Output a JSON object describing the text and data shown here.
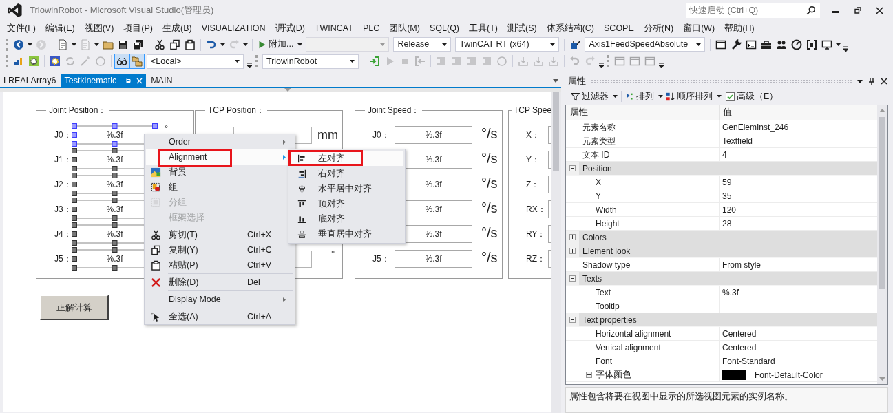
{
  "window": {
    "title": "TriowinRobot - Microsoft Visual Studio(管理员)",
    "quick_launch": {
      "placeholder": "快速启动 (Ctrl+Q)"
    }
  },
  "menu_bar": [
    "文件(F)",
    "编辑(E)",
    "视图(V)",
    "项目(P)",
    "生成(B)",
    "VISUALIZATION",
    "调试(D)",
    "TWINCAT",
    "PLC",
    "团队(M)",
    "SQL(Q)",
    "工具(T)",
    "测试(S)",
    "体系结构(C)",
    "SCOPE",
    "分析(N)",
    "窗口(W)",
    "帮助(H)"
  ],
  "toolbars": [
    [
      {
        "kind": "grip"
      },
      {
        "kind": "icon",
        "disabled": false,
        "toggled": false,
        "dropdown": true
      },
      {
        "kind": "icon",
        "disabled": true,
        "toggled": false
      },
      {
        "kind": "separator"
      },
      {
        "kind": "icon",
        "disabled": false,
        "toggled": false,
        "dropdown": true
      },
      {
        "kind": "icon",
        "disabled": true,
        "toggled": false,
        "dropdown": true
      },
      {
        "kind": "icon",
        "disabled": false,
        "toggled": false
      },
      {
        "kind": "icon",
        "disabled": false,
        "toggled": false
      },
      {
        "kind": "icon",
        "disabled": false,
        "toggled": false
      },
      {
        "kind": "separator"
      },
      {
        "kind": "icon",
        "disabled": false,
        "toggled": false
      },
      {
        "kind": "icon",
        "disabled": false,
        "toggled": false
      },
      {
        "kind": "icon",
        "disabled": false,
        "toggled": false
      },
      {
        "kind": "separator"
      },
      {
        "kind": "icon",
        "disabled": false,
        "toggled": false,
        "dropdown": true
      },
      {
        "kind": "icon",
        "disabled": true,
        "toggled": false,
        "dropdown": true
      },
      {
        "kind": "separator"
      },
      {
        "kind": "button",
        "label": "附加...",
        "dropdown": true
      },
      {
        "kind": "combo",
        "disabled": true
      },
      {
        "kind": "combo",
        "value": "Release",
        "disabled": false
      },
      {
        "kind": "combo",
        "value": "TwinCAT RT (x64)",
        "disabled": false
      },
      {
        "kind": "separator"
      },
      {
        "kind": "icon",
        "disabled": false,
        "toggled": false
      },
      {
        "kind": "combo",
        "value": "Axis1FeedSpeedAbsolute",
        "disabled": false
      },
      {
        "kind": "separator"
      },
      {
        "kind": "icon",
        "disabled": false,
        "toggled": false
      },
      {
        "kind": "icon",
        "disabled": false,
        "toggled": false
      },
      {
        "kind": "icon",
        "disabled": false,
        "toggled": false
      },
      {
        "kind": "icon",
        "disabled": false,
        "toggled": false
      },
      {
        "kind": "icon",
        "disabled": false,
        "toggled": false
      },
      {
        "kind": "icon",
        "disabled": false,
        "toggled": false
      },
      {
        "kind": "icon",
        "disabled": false,
        "toggled": false
      },
      {
        "kind": "icon",
        "disabled": false,
        "toggled": false,
        "dropdown": true
      },
      {
        "kind": "overflow"
      }
    ],
    [
      {
        "kind": "grip"
      },
      {
        "kind": "icon",
        "disabled": false,
        "toggled": false
      },
      {
        "kind": "icon",
        "disabled": false,
        "toggled": false
      },
      {
        "kind": "separator"
      },
      {
        "kind": "icon",
        "disabled": false,
        "toggled": false
      },
      {
        "kind": "icon",
        "disabled": true,
        "toggled": false
      },
      {
        "kind": "icon",
        "disabled": true,
        "toggled": false
      },
      {
        "kind": "icon",
        "disabled": true,
        "toggled": false
      },
      {
        "kind": "separator"
      },
      {
        "kind": "icon",
        "disabled": false,
        "toggled": true
      },
      {
        "kind": "icon",
        "disabled": false,
        "toggled": true
      },
      {
        "kind": "combo",
        "value": "<Local>",
        "disabled": false
      },
      {
        "kind": "overflow"
      },
      {
        "kind": "grip"
      },
      {
        "kind": "combo",
        "value": "TriowinRobot",
        "disabled": false
      },
      {
        "kind": "separator"
      },
      {
        "kind": "icon",
        "disabled": false,
        "toggled": false
      },
      {
        "kind": "icon",
        "disabled": true,
        "toggled": false
      },
      {
        "kind": "icon",
        "disabled": true,
        "toggled": false
      },
      {
        "kind": "icon",
        "disabled": true,
        "toggled": false
      },
      {
        "kind": "separator"
      },
      {
        "kind": "icon",
        "disabled": true,
        "toggled": false
      },
      {
        "kind": "icon",
        "disabled": true,
        "toggled": false
      },
      {
        "kind": "icon",
        "disabled": true,
        "toggled": false
      },
      {
        "kind": "icon",
        "disabled": true,
        "toggled": false
      },
      {
        "kind": "icon",
        "disabled": true,
        "toggled": false
      },
      {
        "kind": "separator"
      },
      {
        "kind": "icon",
        "disabled": true,
        "toggled": false
      },
      {
        "kind": "icon",
        "disabled": true,
        "toggled": false
      },
      {
        "kind": "icon",
        "disabled": true,
        "toggled": false
      },
      {
        "kind": "separator"
      },
      {
        "kind": "icon",
        "disabled": true,
        "toggled": false
      },
      {
        "kind": "icon",
        "disabled": true,
        "toggled": false
      },
      {
        "kind": "overflow"
      },
      {
        "kind": "grip"
      },
      {
        "kind": "icon",
        "disabled": true,
        "toggled": false
      },
      {
        "kind": "icon",
        "disabled": true,
        "toggled": false
      },
      {
        "kind": "icon",
        "disabled": true,
        "toggled": false
      },
      {
        "kind": "overflow"
      }
    ]
  ],
  "tabs": [
    {
      "label": "LREALArray6",
      "selected": false
    },
    {
      "label": "Testkinematic",
      "selected": true
    },
    {
      "label": "MAIN",
      "selected": false
    }
  ],
  "editor": {
    "joint_position": {
      "title": "Joint Position：",
      "rows": [
        {
          "label": "J0：",
          "value": "%.3f",
          "unit": "°",
          "selected": true
        },
        {
          "label": "J1：",
          "value": "%.3f",
          "selected": false
        },
        {
          "label": "J2：",
          "value": "%.3f",
          "selected": false
        },
        {
          "label": "J3：",
          "value": "%.3f",
          "selected": false
        },
        {
          "label": "J4：",
          "value": "%.3f",
          "selected": false
        },
        {
          "label": "J5：",
          "value": "%.3f",
          "selected": false
        }
      ]
    },
    "tcp_position": {
      "title": "TCP Position：",
      "units": [
        "mm",
        "°"
      ]
    },
    "joint_speed": {
      "title": "Joint Speed：",
      "rows": [
        {
          "label": "J0：",
          "value": "%.3f",
          "unit": "°/s"
        },
        {
          "value": "%.3f",
          "unit": "°/s"
        },
        {
          "value": "%.3f",
          "unit": "°/s"
        },
        {
          "value": "%.3f",
          "unit": "°/s"
        },
        {
          "value": "%.3f",
          "unit": "°/s"
        },
        {
          "label": "J5：",
          "value": "%.3f",
          "unit": "°/s"
        }
      ]
    },
    "tcp_speed": {
      "title": "TCP Spee",
      "rows": [
        {
          "label": "X："
        },
        {
          "label": "Y："
        },
        {
          "label": "Z："
        },
        {
          "label": "RX："
        },
        {
          "label": "RY："
        },
        {
          "label": "RZ："
        }
      ]
    },
    "button": "正解计算"
  },
  "context_menu": {
    "items": [
      {
        "kind": "item",
        "label": "Order",
        "submenu": true,
        "disabled": false,
        "selected": false,
        "annotated": false
      },
      {
        "kind": "item",
        "label": "Alignment",
        "submenu": true,
        "disabled": false,
        "selected": true,
        "annotated": true
      },
      {
        "kind": "item",
        "label": "背景",
        "submenu": false,
        "disabled": false,
        "selected": false,
        "annotated": false
      },
      {
        "kind": "item",
        "label": "组",
        "submenu": false,
        "disabled": false,
        "selected": false,
        "annotated": false
      },
      {
        "kind": "item",
        "label": "分组",
        "submenu": false,
        "disabled": true,
        "selected": false,
        "annotated": false
      },
      {
        "kind": "item",
        "label": "框架选择",
        "submenu": false,
        "disabled": true,
        "selected": false,
        "annotated": false
      },
      {
        "kind": "separator"
      },
      {
        "kind": "item",
        "label": "剪切(T)",
        "shortcut": "Ctrl+X",
        "submenu": false,
        "disabled": false,
        "selected": false,
        "annotated": false
      },
      {
        "kind": "item",
        "label": "复制(Y)",
        "shortcut": "Ctrl+C",
        "submenu": false,
        "disabled": false,
        "selected": false,
        "annotated": false
      },
      {
        "kind": "item",
        "label": "粘贴(P)",
        "shortcut": "Ctrl+V",
        "submenu": false,
        "disabled": false,
        "selected": false,
        "annotated": false
      },
      {
        "kind": "separator"
      },
      {
        "kind": "item",
        "label": "删除(D)",
        "shortcut": "Del",
        "submenu": false,
        "disabled": false,
        "selected": false,
        "annotated": false
      },
      {
        "kind": "separator"
      },
      {
        "kind": "item",
        "label": "Display Mode",
        "submenu": true,
        "disabled": false,
        "selected": false,
        "annotated": false
      },
      {
        "kind": "separator"
      },
      {
        "kind": "item",
        "label": "全选(A)",
        "shortcut": "Ctrl+A",
        "submenu": false,
        "disabled": false,
        "selected": false,
        "annotated": false
      }
    ]
  },
  "submenu": {
    "items": [
      {
        "label": "左对齐",
        "selected": true,
        "annotated": true
      },
      {
        "label": "右对齐",
        "selected": false,
        "annotated": false
      },
      {
        "label": "水平居中对齐",
        "selected": false,
        "annotated": false
      },
      {
        "label": "顶对齐",
        "selected": false,
        "annotated": false
      },
      {
        "label": "底对齐",
        "selected": false,
        "annotated": false
      },
      {
        "label": "垂直居中对齐",
        "selected": false,
        "annotated": false
      }
    ]
  },
  "properties_panel": {
    "title": "属性",
    "toolbar": [
      {
        "kind": "dropdown",
        "label": "过滤器"
      },
      {
        "kind": "dropdown",
        "label": "排列"
      },
      {
        "kind": "dropdown",
        "label": "顺序排列"
      },
      {
        "kind": "checkbox",
        "label": "高级（E）",
        "checked": true
      }
    ],
    "columns": [
      "属性",
      "值"
    ],
    "rows": [
      {
        "kind": "property",
        "name": "元素名称",
        "value": "GenElemInst_246"
      },
      {
        "kind": "property",
        "name": "元素类型",
        "value": "Textfield"
      },
      {
        "kind": "property",
        "name": "文本 ID",
        "value": "4"
      },
      {
        "kind": "category",
        "name": "Position",
        "expanded": true,
        "children": [
          {
            "kind": "property",
            "name": "X",
            "value": "59"
          },
          {
            "kind": "property",
            "name": "Y",
            "value": "35"
          },
          {
            "kind": "property",
            "name": "Width",
            "value": "120"
          },
          {
            "kind": "property",
            "name": "Height",
            "value": "28"
          }
        ]
      },
      {
        "kind": "category",
        "name": "Colors",
        "expanded": false
      },
      {
        "kind": "category",
        "name": "Element look",
        "expanded": false
      },
      {
        "kind": "property",
        "name": "Shadow type",
        "value": "From style"
      },
      {
        "kind": "category",
        "name": "Texts",
        "expanded": true,
        "children": [
          {
            "kind": "property",
            "name": "Text",
            "value": "%.3f"
          },
          {
            "kind": "property",
            "name": "Tooltip"
          }
        ]
      },
      {
        "kind": "category",
        "name": "Text properties",
        "expanded": true,
        "children": [
          {
            "kind": "property",
            "name": "Horizontal alignment",
            "value": "Centered"
          },
          {
            "kind": "property",
            "name": "Vertical alignment",
            "value": "Centered"
          },
          {
            "kind": "property",
            "name": "Font",
            "value": "Font-Standard"
          },
          {
            "kind": "category",
            "name": "字体颜色",
            "expanded": true,
            "color": "#000000",
            "value": "Font-Default-Color"
          }
        ]
      }
    ],
    "description": "属性包含将要在视图中显示的所选视图元素的实例名称。"
  }
}
